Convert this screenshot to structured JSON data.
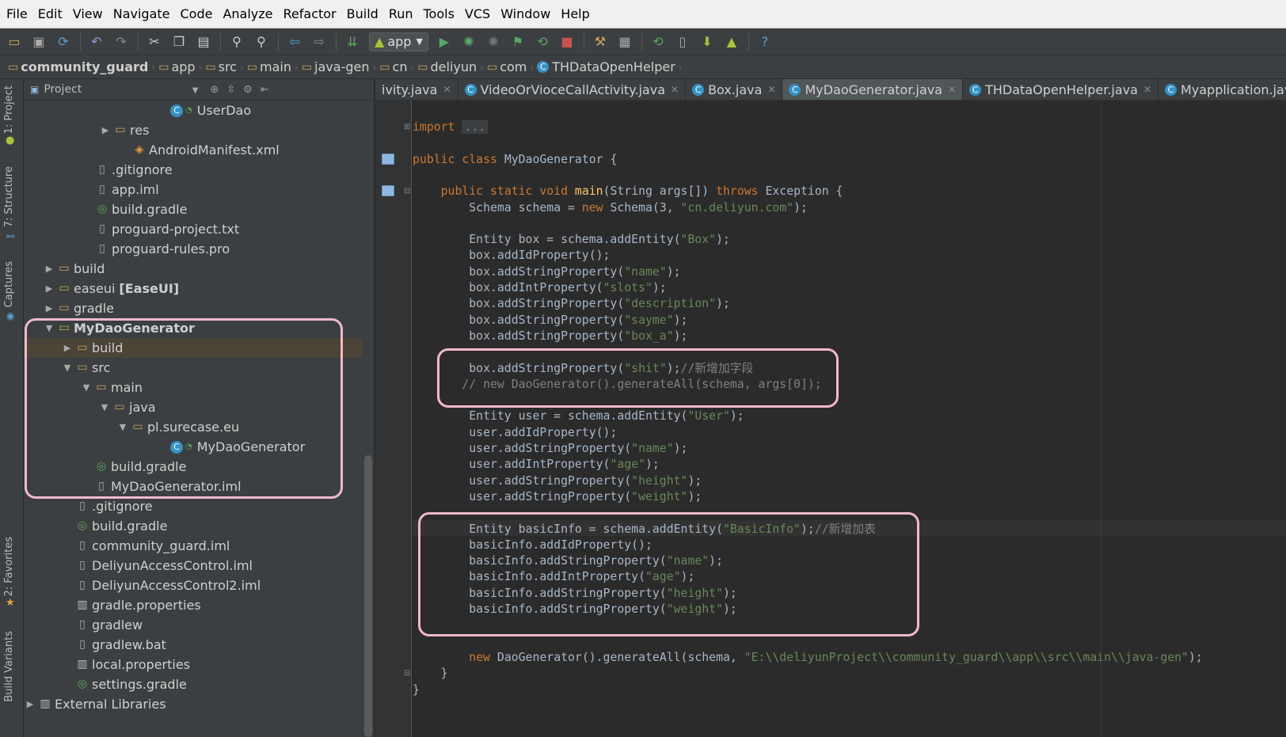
{
  "menu": [
    "File",
    "Edit",
    "View",
    "Navigate",
    "Code",
    "Analyze",
    "Refactor",
    "Build",
    "Run",
    "Tools",
    "VCS",
    "Window",
    "Help"
  ],
  "toolbar": {
    "run_config": "app",
    "help": "?"
  },
  "breadcrumb": [
    "community_guard",
    "app",
    "src",
    "main",
    "java-gen",
    "cn",
    "deliyun",
    "com",
    "THDataOpenHelper"
  ],
  "sidebar": {
    "project": "1: Project",
    "structure": "7: Structure",
    "captures": "Captures",
    "favorites": "2: Favorites",
    "build_variants": "Build Variants"
  },
  "project_panel": {
    "title": "Project"
  },
  "tree": [
    {
      "label": "UserDao",
      "icon": "class",
      "expander": ""
    },
    {
      "label": "res",
      "icon": "folder",
      "expander": "▶"
    },
    {
      "label": "AndroidManifest.xml",
      "icon": "xml",
      "expander": ""
    },
    {
      "label": ".gitignore",
      "icon": "file",
      "expander": ""
    },
    {
      "label": "app.iml",
      "icon": "file",
      "expander": ""
    },
    {
      "label": "build.gradle",
      "icon": "gradle",
      "expander": ""
    },
    {
      "label": "proguard-project.txt",
      "icon": "file",
      "expander": ""
    },
    {
      "label": "proguard-rules.pro",
      "icon": "file",
      "expander": ""
    },
    {
      "label": "build",
      "icon": "folder",
      "expander": "▶"
    },
    {
      "label": "easeui",
      "suffix": "[EaseUI]",
      "icon": "folder",
      "expander": "▶"
    },
    {
      "label": "gradle",
      "icon": "folder",
      "expander": "▶"
    },
    {
      "label": "MyDaoGenerator",
      "icon": "folder",
      "expander": "▼"
    },
    {
      "label": "build",
      "icon": "folder",
      "expander": "▶"
    },
    {
      "label": "src",
      "icon": "folder",
      "expander": "▼"
    },
    {
      "label": "main",
      "icon": "folder",
      "expander": "▼"
    },
    {
      "label": "java",
      "icon": "folder",
      "expander": "▼"
    },
    {
      "label": "pl.surecase.eu",
      "icon": "folder",
      "expander": "▼"
    },
    {
      "label": "MyDaoGenerator",
      "icon": "class",
      "expander": ""
    },
    {
      "label": "build.gradle",
      "icon": "gradle",
      "expander": ""
    },
    {
      "label": "MyDaoGenerator.iml",
      "icon": "file",
      "expander": ""
    },
    {
      "label": ".gitignore",
      "icon": "file",
      "expander": ""
    },
    {
      "label": "build.gradle",
      "icon": "gradle",
      "expander": ""
    },
    {
      "label": "community_guard.iml",
      "icon": "file",
      "expander": ""
    },
    {
      "label": "DeliyunAccessControl.iml",
      "icon": "file",
      "expander": ""
    },
    {
      "label": "DeliyunAccessControl2.iml",
      "icon": "file",
      "expander": ""
    },
    {
      "label": "gradle.properties",
      "icon": "lib",
      "expander": ""
    },
    {
      "label": "gradlew",
      "icon": "file",
      "expander": ""
    },
    {
      "label": "gradlew.bat",
      "icon": "file",
      "expander": ""
    },
    {
      "label": "local.properties",
      "icon": "lib",
      "expander": ""
    },
    {
      "label": "settings.gradle",
      "icon": "gradle",
      "expander": ""
    },
    {
      "label": "External Libraries",
      "icon": "lib",
      "expander": "▶"
    }
  ],
  "tabs": [
    {
      "label": "ivity.java",
      "icon": false,
      "active": false
    },
    {
      "label": "VideoOrVioceCallActivity.java",
      "icon": true,
      "active": false
    },
    {
      "label": "Box.java",
      "icon": true,
      "active": false
    },
    {
      "label": "MyDaoGenerator.java",
      "icon": true,
      "active": true
    },
    {
      "label": "THDataOpenHelper.java",
      "icon": true,
      "active": false
    },
    {
      "label": "Myapplication.java",
      "icon": true,
      "active": false
    }
  ],
  "code": [
    [
      [
        "kw",
        "import"
      ],
      [
        "plain",
        " "
      ],
      [
        "fold",
        "..."
      ]
    ],
    [],
    [
      [
        "kw",
        "public class"
      ],
      [
        "plain",
        " MyDaoGenerator {"
      ]
    ],
    [],
    [
      [
        "plain",
        "    "
      ],
      [
        "kw",
        "public static void"
      ],
      [
        "plain",
        " "
      ],
      [
        "fn",
        "main"
      ],
      [
        "plain",
        "(String args[]) "
      ],
      [
        "kw",
        "throws"
      ],
      [
        "plain",
        " Exception {"
      ]
    ],
    [
      [
        "plain",
        "        Schema schema = "
      ],
      [
        "kw",
        "new"
      ],
      [
        "plain",
        " Schema(3, "
      ],
      [
        "str",
        "\"cn.deliyun.com\""
      ],
      [
        "plain",
        ");"
      ]
    ],
    [],
    [
      [
        "plain",
        "        Entity box = schema.addEntity("
      ],
      [
        "str",
        "\"Box\""
      ],
      [
        "plain",
        ");"
      ]
    ],
    [
      [
        "plain",
        "        box.addIdProperty();"
      ]
    ],
    [
      [
        "plain",
        "        box.addStringProperty("
      ],
      [
        "str",
        "\"name\""
      ],
      [
        "plain",
        ");"
      ]
    ],
    [
      [
        "plain",
        "        box.addIntProperty("
      ],
      [
        "str",
        "\"slots\""
      ],
      [
        "plain",
        ");"
      ]
    ],
    [
      [
        "plain",
        "        box.addStringProperty("
      ],
      [
        "str",
        "\"description\""
      ],
      [
        "plain",
        ");"
      ]
    ],
    [
      [
        "plain",
        "        box.addStringProperty("
      ],
      [
        "str",
        "\"sayme\""
      ],
      [
        "plain",
        ");"
      ]
    ],
    [
      [
        "plain",
        "        box.addStringProperty("
      ],
      [
        "str",
        "\"box_a\""
      ],
      [
        "plain",
        ");"
      ]
    ],
    [],
    [
      [
        "plain",
        "        box.addStringProperty("
      ],
      [
        "str",
        "\"shit\""
      ],
      [
        "plain",
        ");"
      ],
      [
        "cmt",
        "//新增加字段"
      ]
    ],
    [
      [
        "cmt",
        "       // new DaoGenerator().generateAll(schema, args[0]);"
      ]
    ],
    [],
    [
      [
        "plain",
        "        Entity user = schema.addEntity("
      ],
      [
        "str",
        "\"User\""
      ],
      [
        "plain",
        ");"
      ]
    ],
    [
      [
        "plain",
        "        user.addIdProperty();"
      ]
    ],
    [
      [
        "plain",
        "        user.addStringProperty("
      ],
      [
        "str",
        "\"name\""
      ],
      [
        "plain",
        ");"
      ]
    ],
    [
      [
        "plain",
        "        user.addIntProperty("
      ],
      [
        "str",
        "\"age\""
      ],
      [
        "plain",
        ");"
      ]
    ],
    [
      [
        "plain",
        "        user.addStringProperty("
      ],
      [
        "str",
        "\"height\""
      ],
      [
        "plain",
        ");"
      ]
    ],
    [
      [
        "plain",
        "        user.addStringProperty("
      ],
      [
        "str",
        "\"weight\""
      ],
      [
        "plain",
        ");"
      ]
    ],
    [],
    [
      [
        "plain",
        "        Entity basicInfo = schema.addEntity("
      ],
      [
        "str",
        "\"BasicInfo\""
      ],
      [
        "plain",
        ");"
      ],
      [
        "cmt",
        "//新增加表"
      ]
    ],
    [
      [
        "plain",
        "        basicInfo.addIdProperty();"
      ]
    ],
    [
      [
        "plain",
        "        basicInfo.addStringProperty("
      ],
      [
        "str",
        "\"name\""
      ],
      [
        "plain",
        ");"
      ]
    ],
    [
      [
        "plain",
        "        basicInfo.addIntProperty("
      ],
      [
        "str",
        "\"age\""
      ],
      [
        "plain",
        ");"
      ]
    ],
    [
      [
        "plain",
        "        basicInfo.addStringProperty("
      ],
      [
        "str",
        "\"height\""
      ],
      [
        "plain",
        ");"
      ]
    ],
    [
      [
        "plain",
        "        basicInfo.addStringProperty("
      ],
      [
        "str",
        "\"weight\""
      ],
      [
        "plain",
        ");"
      ]
    ],
    [],
    [],
    [
      [
        "plain",
        "        "
      ],
      [
        "kw",
        "new"
      ],
      [
        "plain",
        " DaoGenerator().generateAll(schema, "
      ],
      [
        "str",
        "\"E:\\\\deliyunProject\\\\community_guard\\\\app\\\\src\\\\main\\\\java-gen\""
      ],
      [
        "plain",
        ");"
      ]
    ],
    [
      [
        "plain",
        "    }"
      ]
    ],
    [
      [
        "plain",
        "}"
      ]
    ]
  ]
}
